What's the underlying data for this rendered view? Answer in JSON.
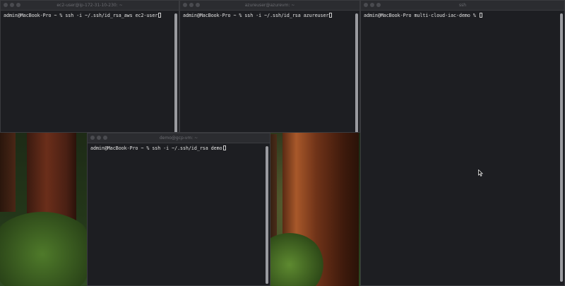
{
  "windows": {
    "top_left": {
      "title": "ec2-user@ip-172-31-10-230: ~",
      "prompt": "admin@MacBook-Pro ~ % ssh -i ~/.ssh/id_rsa_aws ec2-user"
    },
    "top_middle": {
      "title": "azureuser@azurevm: ~",
      "prompt": "admin@MacBook-Pro ~ % ssh -i ~/.ssh/id_rsa azureuser"
    },
    "right": {
      "title": "ssh",
      "prompt": "admin@MacBook-Pro multi-cloud-iac-demo % "
    },
    "bottom_middle": {
      "title": "demo@gcp-vm: ~",
      "prompt": "admin@MacBook-Pro ~ % ssh -i ~/.ssh/id_rsa demo"
    }
  },
  "colors": {
    "terminal_bg": "#1d1e22",
    "terminal_text": "#e4e4e4",
    "titlebar_bg": "#2b2c30"
  },
  "icons": {
    "cursor": "mouse-pointer-icon"
  }
}
